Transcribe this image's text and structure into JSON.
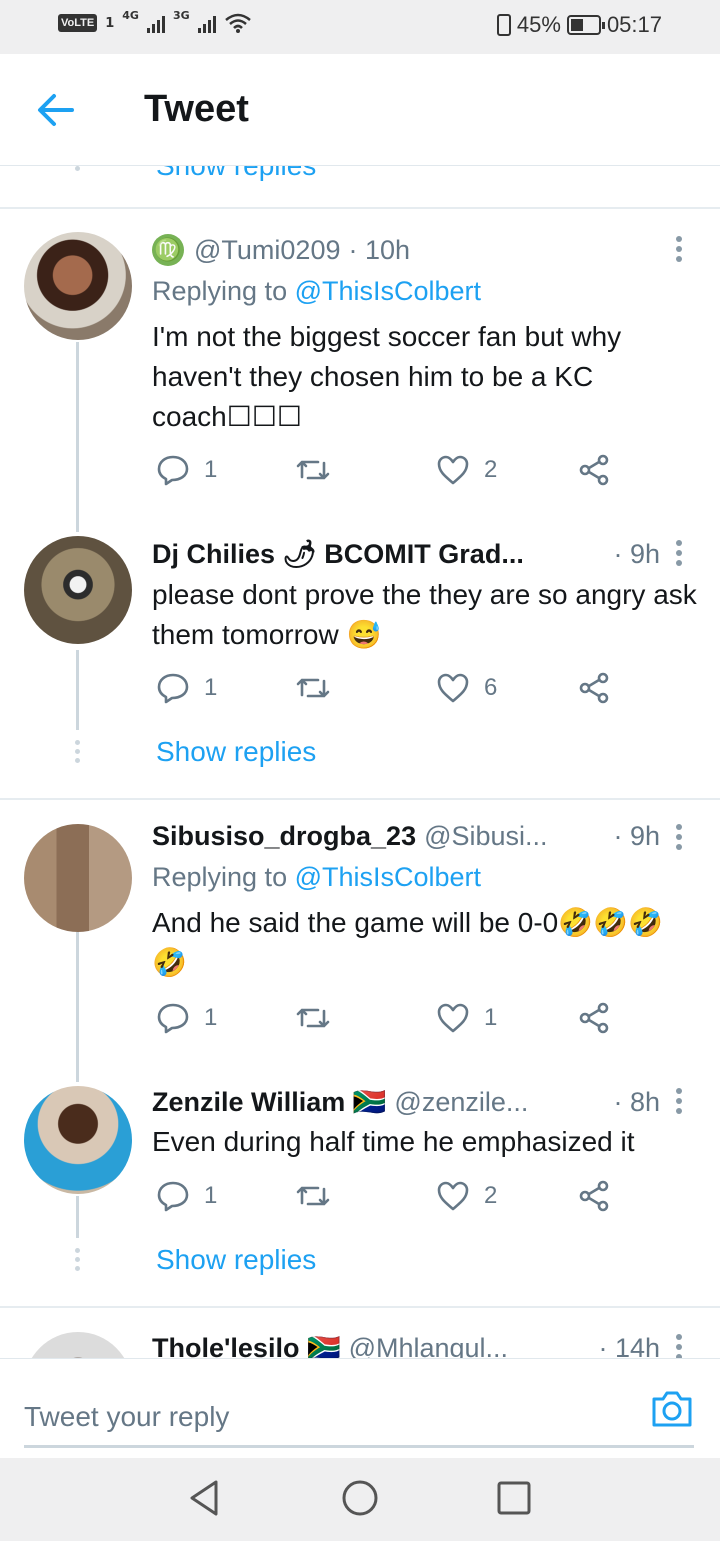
{
  "status_bar": {
    "volte": "VoLTE",
    "sim": "1",
    "net1": "4G",
    "net2": "3G",
    "battery": "45%",
    "battery_level": 0.45,
    "time": "05:17"
  },
  "header": {
    "title": "Tweet"
  },
  "colors": {
    "accent": "#1da1f2",
    "muted": "#657786",
    "divider": "#e6ecf0"
  },
  "cut_off": {
    "show_replies": "Show replies"
  },
  "tweets": [
    {
      "badge": "♍",
      "name": "",
      "handle": "@Tumi0209",
      "time": "· 10h",
      "replying_prefix": "Replying to ",
      "replying_to": "@ThisIsColbert",
      "text": "I'm not the biggest soccer fan but why haven't they chosen him to be a KC coach☐☐☐",
      "replies": "1",
      "retweets": "",
      "likes": "2"
    },
    {
      "name": "Dj Chilies 🌶 BCOMIT Grad...",
      "handle": "",
      "time": "· 9h",
      "text": "please dont prove the they are so angry ask them tomorrow 😅",
      "replies": "1",
      "retweets": "",
      "likes": "6",
      "show_replies": "Show replies"
    },
    {
      "name": "Sibusiso_drogba_23",
      "handle": "@Sibusi...",
      "time": "· 9h",
      "replying_prefix": "Replying to ",
      "replying_to": "@ThisIsColbert",
      "text": "And he said the game will be 0-0🤣🤣🤣🤣",
      "replies": "1",
      "retweets": "",
      "likes": "1"
    },
    {
      "name": "Zenzile William 🇿🇦",
      "handle": "@zenzile...",
      "time": "· 8h",
      "text": "Even during half time he emphasized it",
      "replies": "1",
      "retweets": "",
      "likes": "2",
      "show_replies": "Show replies"
    },
    {
      "name": "Thole'lesilo 🇿🇦",
      "handle": "@Mhlangul...",
      "time": "· 14h"
    }
  ],
  "reply_bar": {
    "placeholder": "Tweet your reply"
  }
}
